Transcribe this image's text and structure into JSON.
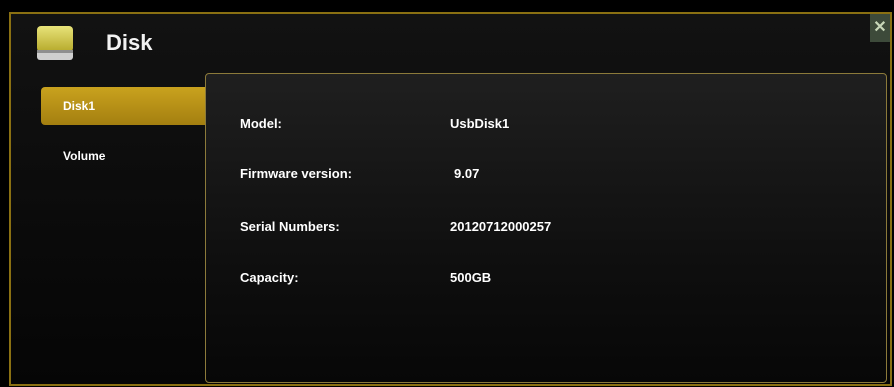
{
  "window": {
    "title": "Disk",
    "close_icon": "close-icon",
    "icon": "disk-icon",
    "accent_color": "#b18a14"
  },
  "sidebar": {
    "items": [
      {
        "label": "Disk1",
        "active": true
      },
      {
        "label": "Volume",
        "active": false
      }
    ]
  },
  "details": {
    "model_label": "Model:",
    "model_value": "UsbDisk1",
    "firmware_label": "Firmware version:",
    "firmware_value": "9.07",
    "serial_label": "Serial Numbers:",
    "serial_value": "20120712000257",
    "capacity_label": "Capacity:",
    "capacity_value": "500GB"
  }
}
